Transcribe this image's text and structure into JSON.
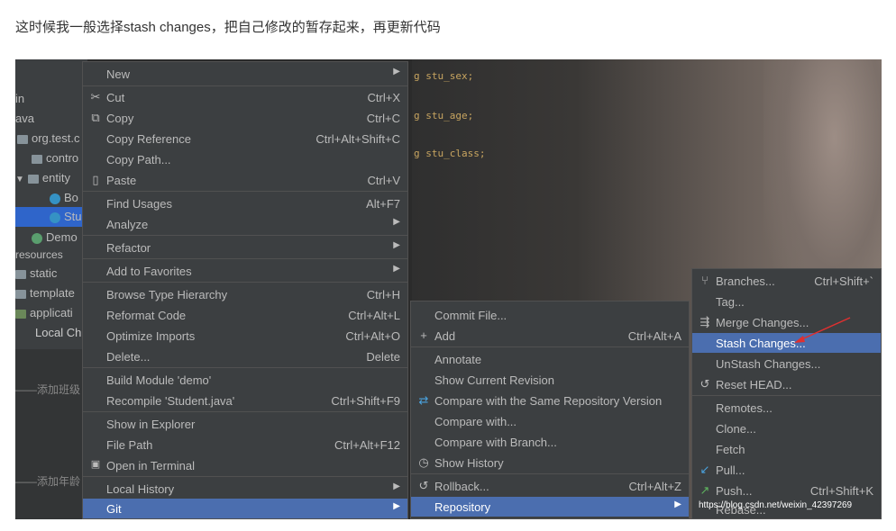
{
  "caption": "这时候我一般选择stash changes，把自己修改的暂存起来，再更新代码",
  "code": [
    "g stu_sex;",
    "g stu_age;",
    "g stu_class;"
  ],
  "tree": {
    "items": [
      "in",
      "ava",
      "org.test.c",
      "contro",
      "entity",
      "Bo",
      "Stu",
      "Demo",
      "resources",
      "static",
      "template",
      "applicati",
      "Local Ch"
    ],
    "bottom": [
      "——添加班级",
      "——添加年龄"
    ]
  },
  "main_menu": {
    "items": [
      {
        "label": "New",
        "shortcut": "",
        "submenu": true
      },
      {
        "label": "Cut",
        "shortcut": "Ctrl+X",
        "icon": "scissors-icon"
      },
      {
        "label": "Copy",
        "shortcut": "Ctrl+C",
        "icon": "copy-icon"
      },
      {
        "label": "Copy Reference",
        "shortcut": "Ctrl+Alt+Shift+C"
      },
      {
        "label": "Copy Path...",
        "shortcut": ""
      },
      {
        "label": "Paste",
        "shortcut": "Ctrl+V",
        "icon": "paste-icon"
      },
      {
        "label": "Find Usages",
        "shortcut": "Alt+F7"
      },
      {
        "label": "Analyze",
        "shortcut": "",
        "submenu": true
      },
      {
        "label": "Refactor",
        "shortcut": "",
        "submenu": true
      },
      {
        "label": "Add to Favorites",
        "shortcut": "",
        "submenu": true
      },
      {
        "label": "Browse Type Hierarchy",
        "shortcut": "Ctrl+H"
      },
      {
        "label": "Reformat Code",
        "shortcut": "Ctrl+Alt+L"
      },
      {
        "label": "Optimize Imports",
        "shortcut": "Ctrl+Alt+O"
      },
      {
        "label": "Delete...",
        "shortcut": "Delete"
      },
      {
        "label": "Build Module 'demo'",
        "shortcut": ""
      },
      {
        "label": "Recompile 'Student.java'",
        "shortcut": "Ctrl+Shift+F9"
      },
      {
        "label": "Show in Explorer",
        "shortcut": ""
      },
      {
        "label": "File Path",
        "shortcut": "Ctrl+Alt+F12"
      },
      {
        "label": "Open in Terminal",
        "shortcut": "",
        "icon": "terminal-icon"
      },
      {
        "label": "Local History",
        "shortcut": "",
        "submenu": true
      },
      {
        "label": "Git",
        "shortcut": "",
        "submenu": true
      }
    ]
  },
  "git_menu": {
    "items": [
      {
        "label": "Commit File...",
        "shortcut": ""
      },
      {
        "label": "Add",
        "shortcut": "Ctrl+Alt+A",
        "icon": "plus-icon"
      },
      {
        "label": "Annotate",
        "shortcut": ""
      },
      {
        "label": "Show Current Revision",
        "shortcut": ""
      },
      {
        "label": "Compare with the Same Repository Version",
        "shortcut": "",
        "icon": "compare-icon"
      },
      {
        "label": "Compare with...",
        "shortcut": ""
      },
      {
        "label": "Compare with Branch...",
        "shortcut": ""
      },
      {
        "label": "Show History",
        "shortcut": "",
        "icon": "clock-icon"
      },
      {
        "label": "Rollback...",
        "shortcut": "Ctrl+Alt+Z",
        "icon": "rollback-icon"
      },
      {
        "label": "Repository",
        "shortcut": "",
        "submenu": true
      }
    ]
  },
  "repo_menu": {
    "items": [
      {
        "label": "Branches...",
        "shortcut": "Ctrl+Shift+`",
        "icon": "branch-icon"
      },
      {
        "label": "Tag...",
        "shortcut": ""
      },
      {
        "label": "Merge Changes...",
        "shortcut": "",
        "icon": "merge-icon"
      },
      {
        "label": "Stash Changes...",
        "shortcut": ""
      },
      {
        "label": "UnStash Changes...",
        "shortcut": ""
      },
      {
        "label": "Reset HEAD...",
        "shortcut": "",
        "icon": "reset-icon"
      },
      {
        "label": "Remotes...",
        "shortcut": ""
      },
      {
        "label": "Clone...",
        "shortcut": ""
      },
      {
        "label": "Fetch",
        "shortcut": ""
      },
      {
        "label": "Pull...",
        "shortcut": "",
        "icon": "pull-icon"
      },
      {
        "label": "Push...",
        "shortcut": "Ctrl+Shift+K",
        "icon": "push-icon"
      },
      {
        "label": "Rebase...",
        "shortcut": ""
      }
    ]
  },
  "watermark": "https://blog.csdn.net/weixin_42397269",
  "colors": {
    "menu_bg": "#3c3f41",
    "selection": "#4b6eaf",
    "text": "#bbbbbb",
    "arrow": "#e03030"
  }
}
